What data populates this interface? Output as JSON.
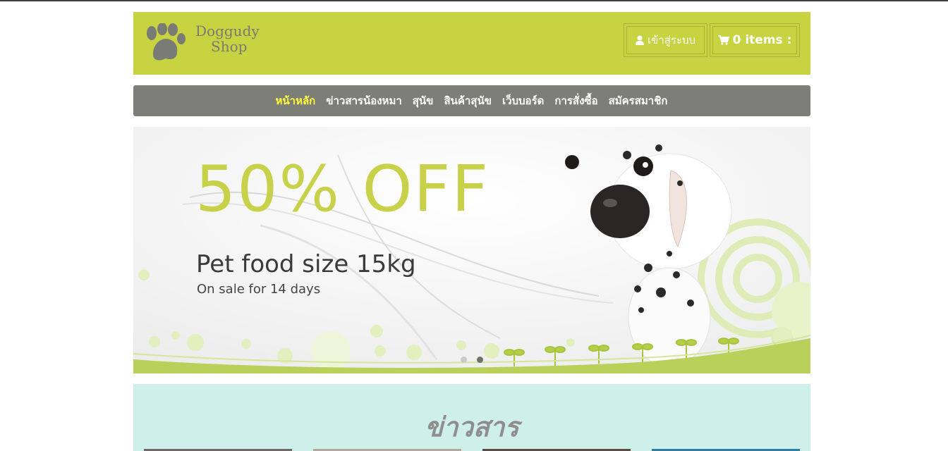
{
  "logo": {
    "line1": "Doggudy",
    "line2": "Shop"
  },
  "header": {
    "login_label": "เข้าสู่ระบบ",
    "cart_label": "0 items :"
  },
  "nav": {
    "items": [
      {
        "label": "หน้าหลัก",
        "active": true
      },
      {
        "label": "ข่าวสารน้องหมา",
        "active": false
      },
      {
        "label": "สุนัข",
        "active": false
      },
      {
        "label": "สินค้าสุนัข",
        "active": false
      },
      {
        "label": "เว็บบอร์ด",
        "active": false
      },
      {
        "label": "การสั่งซื้อ",
        "active": false
      },
      {
        "label": "สมัครสมาชิก",
        "active": false
      }
    ]
  },
  "banner": {
    "headline": "50% OFF",
    "subtitle": "Pet food  size 15kg",
    "note": "On sale for 14 days"
  },
  "news": {
    "title": "ข่าวสาร"
  },
  "colors": {
    "header_bg": "#c8d342",
    "nav_bg": "#7d7e77",
    "nav_active": "#ffff3a",
    "promo": "#c7d24a",
    "news_bg": "#cff0ea"
  },
  "icons": [
    "paw-icon",
    "user-icon",
    "cart-icon"
  ]
}
